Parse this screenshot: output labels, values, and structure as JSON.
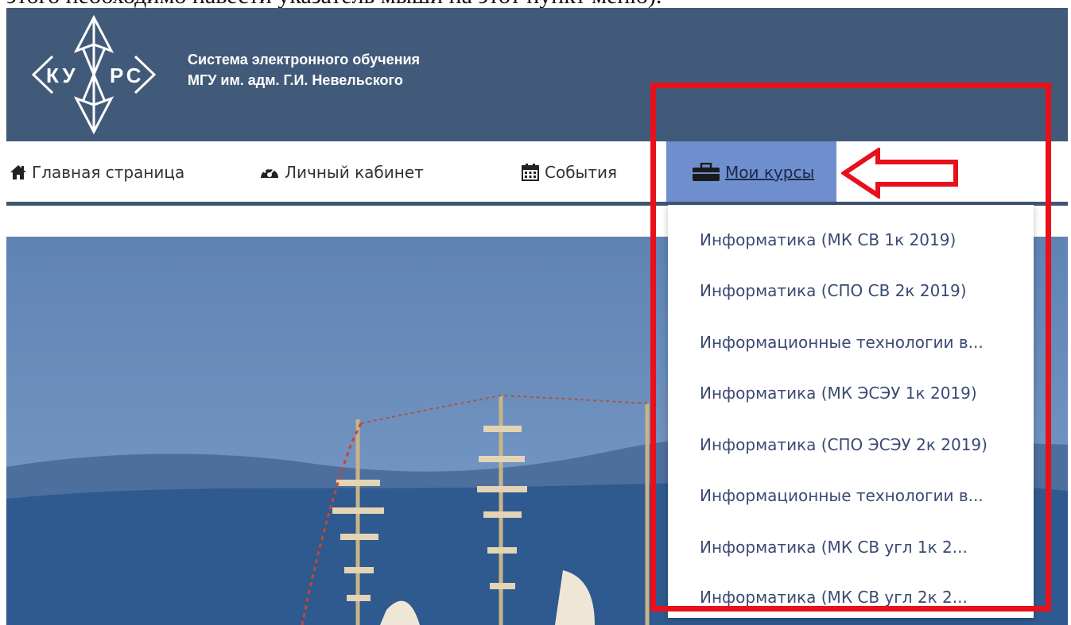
{
  "document": {
    "caption_fragment": "этого необходимо навести указатель мыши на этот пункт меню)."
  },
  "header": {
    "logo_text": "КУ РС",
    "title_line1": "Система электронного обучения",
    "title_line2": "МГУ им. адм. Г.И. Невельского",
    "bg_color": "#425a79"
  },
  "nav": {
    "items": [
      {
        "label": "Главная страница",
        "icon": "home-icon"
      },
      {
        "label": "Личный кабинет",
        "icon": "dashboard-icon"
      },
      {
        "label": "События",
        "icon": "calendar-icon"
      },
      {
        "label": "Мои курсы",
        "icon": "briefcase-icon",
        "active": true
      }
    ],
    "active_color": "#6f8fcf"
  },
  "dropdown": {
    "items": [
      "Информатика (МК СВ 1к 2019)",
      "Информатика (СПО СВ 2к 2019)",
      "Информационные технологии в...",
      "Информатика (МК ЭСЭУ 1к 2019)",
      "Информатика (СПО ЭСЭУ 2к 2019)",
      "Информационные технологии в...",
      "Информатика (МК СВ угл 1к 2...",
      "Информатика (МК СВ угл 2к 2..."
    ]
  },
  "annotation": {
    "color": "#e8101a"
  }
}
